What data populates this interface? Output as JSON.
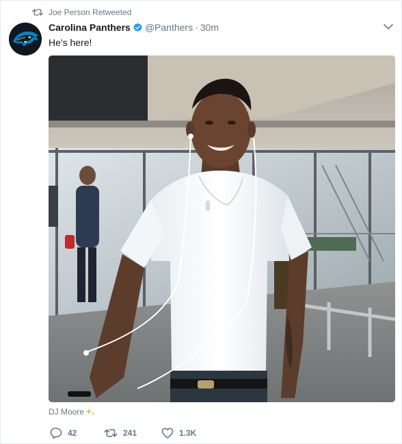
{
  "retweet_context": {
    "text": "Joe Person Retweeted",
    "icon": "retweet-icon"
  },
  "author": {
    "display_name": "Carolina Panthers",
    "handle": "@Panthers",
    "separator": "·",
    "time": "30m",
    "verified": true,
    "avatar_icon": "panther-logo-icon"
  },
  "tweet": {
    "text": "He's here!"
  },
  "media": {
    "tagged_user": "DJ Moore",
    "tag_icon": "sparkle-emoji-icon"
  },
  "actions": {
    "reply_count": "42",
    "retweet_count": "241",
    "like_count": "1.3K"
  },
  "colors": {
    "secondary_text": "#657786",
    "verified_blue": "#1da1f2",
    "panthers_blue": "#0085ca"
  }
}
